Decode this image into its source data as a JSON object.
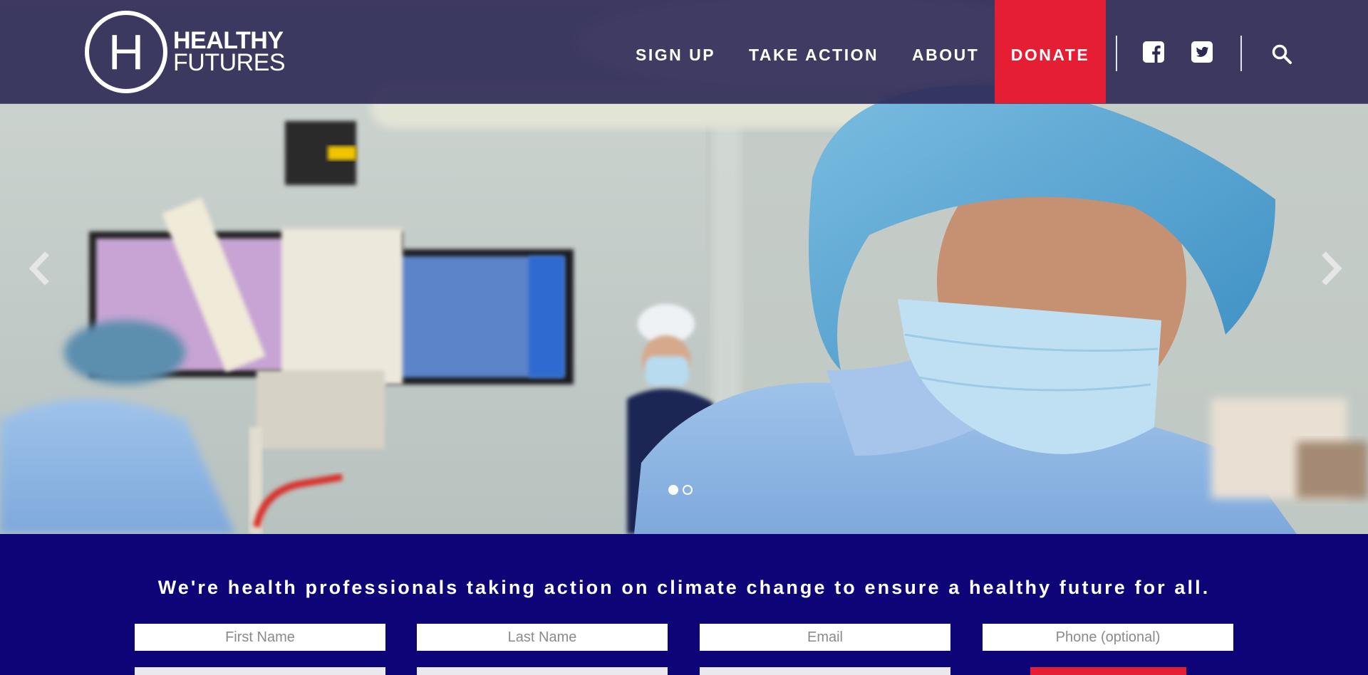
{
  "logo": {
    "letter": "H",
    "line1": "HEALTHY",
    "line2": "FUTURES"
  },
  "nav": {
    "sign_up": "SIGN UP",
    "take_action": "TAKE ACTION",
    "about": "ABOUT",
    "donate": "DONATE"
  },
  "icons": {
    "facebook": "facebook-icon",
    "twitter": "twitter-icon",
    "search": "search-icon",
    "prev": "chevron-left-icon",
    "next": "chevron-right-icon"
  },
  "carousel": {
    "slide_count": 2,
    "active_index": 0
  },
  "signup": {
    "tagline": "We're health professionals taking action on climate change to ensure a healthy future for all.",
    "first_name_placeholder": "First Name",
    "last_name_placeholder": "Last Name",
    "email_placeholder": "Email",
    "phone_placeholder": "Phone (optional)"
  },
  "colors": {
    "header": "#2c2854",
    "donate": "#e61e34",
    "band": "#0d0478"
  }
}
